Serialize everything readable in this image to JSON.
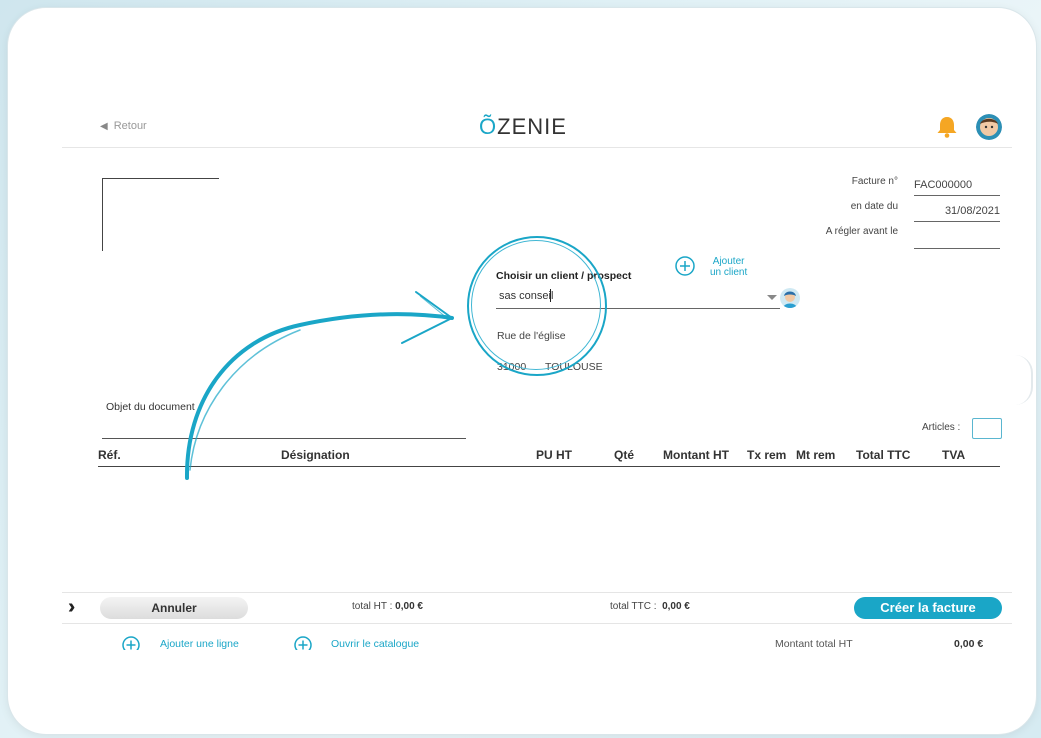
{
  "header": {
    "back_label": "Retour",
    "logo_text": "ZENIE",
    "logo_o": "Õ"
  },
  "invoice": {
    "number_label": "Facture n°",
    "number_value": "FAC000000",
    "date_label": "en date du",
    "date_value": "31/08/2021",
    "due_label": "A régler avant le",
    "due_value": ""
  },
  "client": {
    "title": "Choisir un client / prospect",
    "input_value": "sas conseil",
    "address_line": "Rue de l'église",
    "postal_code": "31000",
    "city": "TOULOUSE",
    "add_label_1": "Ajouter",
    "add_label_2": "un client"
  },
  "document": {
    "objet_label": "Objet du document",
    "articles_label": "Articles :"
  },
  "table": {
    "headers": [
      "Réf.",
      "Désignation",
      "PU HT",
      "Qté",
      "Montant HT",
      "Tx rem",
      "Mt rem",
      "Total TTC",
      "TVA"
    ]
  },
  "footer": {
    "cancel_label": "Annuler",
    "total_ht_label": "total HT :",
    "total_ht_value": "0,00 €",
    "total_ttc_label": "total TTC :",
    "total_ttc_value": "0,00 €",
    "create_label": "Créer la facture"
  },
  "bottom": {
    "add_line_label": "Ajouter une ligne",
    "catalog_label": "Ouvrir le catalogue",
    "montant_label": "Montant total HT",
    "montant_value": "0,00 €"
  },
  "colors": {
    "accent": "#1aa6c7",
    "bell": "#f5a623"
  }
}
